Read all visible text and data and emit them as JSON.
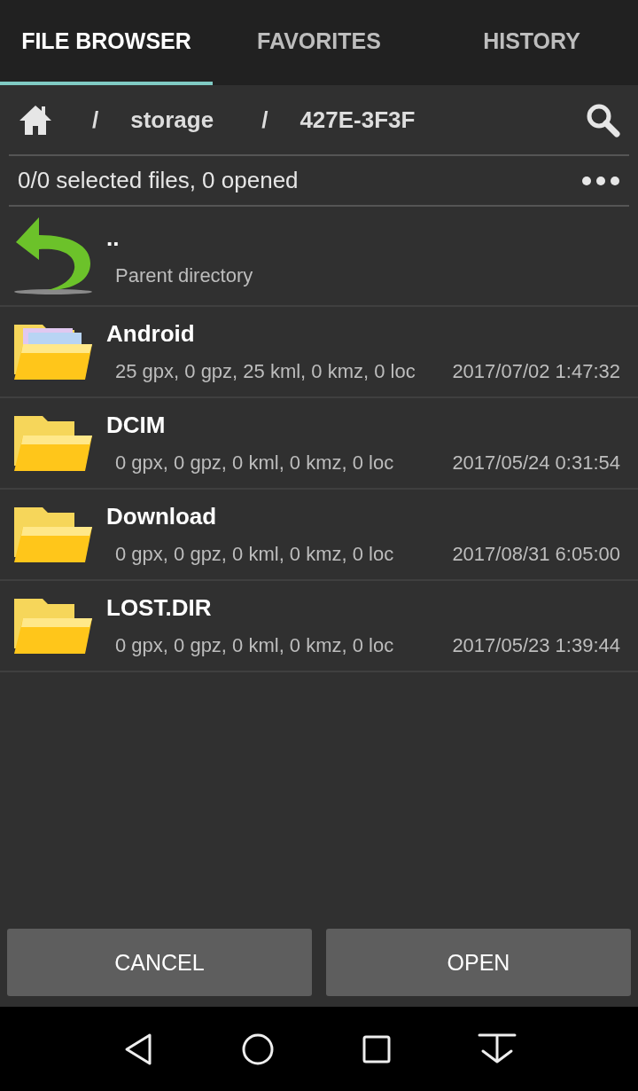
{
  "tabs": [
    {
      "label": "FILE BROWSER",
      "selected": true
    },
    {
      "label": "FAVORITES",
      "selected": false
    },
    {
      "label": "HISTORY",
      "selected": false
    }
  ],
  "path": {
    "separators": [
      "/",
      "/"
    ],
    "segments": [
      "storage",
      "427E-3F3F"
    ]
  },
  "status": {
    "text": "0/0 selected files, 0 opened"
  },
  "entries": [
    {
      "kind": "parent",
      "name": "..",
      "detail": "Parent directory"
    },
    {
      "kind": "folder-files",
      "name": "Android",
      "detail": "25 gpx, 0 gpz, 25 kml, 0 kmz, 0 loc",
      "date": "2017/07/02 1:47:32"
    },
    {
      "kind": "folder",
      "name": "DCIM",
      "detail": "0 gpx, 0 gpz, 0 kml, 0 kmz, 0 loc",
      "date": "2017/05/24 0:31:54"
    },
    {
      "kind": "folder",
      "name": "Download",
      "detail": "0 gpx, 0 gpz, 0 kml, 0 kmz, 0 loc",
      "date": "2017/08/31 6:05:00"
    },
    {
      "kind": "folder",
      "name": "LOST.DIR",
      "detail": "0 gpx, 0 gpz, 0 kml, 0 kmz, 0 loc",
      "date": "2017/05/23 1:39:44"
    }
  ],
  "buttons": [
    "CANCEL",
    "OPEN"
  ]
}
